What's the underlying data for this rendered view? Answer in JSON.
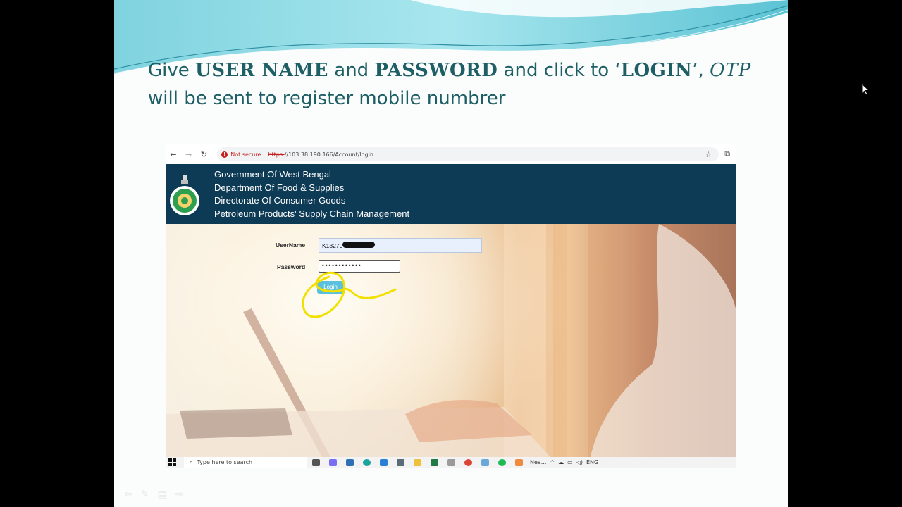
{
  "slide": {
    "heading": {
      "line1": [
        {
          "text": "Give ",
          "style": "plain"
        },
        {
          "text": "USER NAME",
          "style": "kw"
        },
        {
          "text": " and ",
          "style": "plain"
        },
        {
          "text": "PASSWORD",
          "style": "kw"
        },
        {
          "text": " and click to ‘",
          "style": "plain"
        },
        {
          "text": "LOGIN",
          "style": "kw"
        },
        {
          "text": "’, ",
          "style": "plain"
        },
        {
          "text": "OTP",
          "style": "otp"
        }
      ],
      "line2": "will be sent to register mobile numbrer"
    }
  },
  "browser": {
    "security_label": "Not secure",
    "url_scheme": "https:",
    "url_rest": "//103.38.190.166/Account/login"
  },
  "app": {
    "header_lines": [
      "Government Of West Bengal",
      "Department Of Food & Supplies",
      "Directorate Of Consumer Goods",
      "Petroleum Products' Supply Chain Management"
    ],
    "form": {
      "username_label": "UserName",
      "username_value": "K13270",
      "password_label": "Password",
      "password_value": "••••••••••••",
      "login_button": "Login"
    }
  },
  "taskbar": {
    "search_placeholder": "Type here to search",
    "weather_label": "Nea...",
    "language": "ENG"
  },
  "colors": {
    "heading": "#1e5f66",
    "app_header": "#0d3a55",
    "login_button": "#5bc0de",
    "highlight_scribble": "#f2e000",
    "not_secure": "#c5221f"
  }
}
